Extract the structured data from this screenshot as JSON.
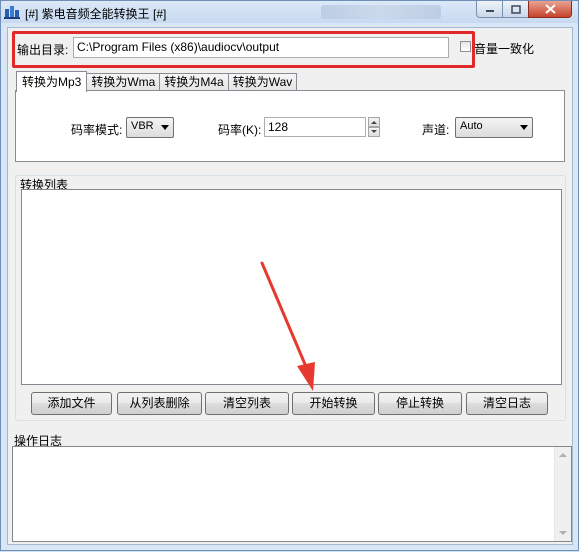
{
  "window": {
    "title": "[#] 紫电音频全能转换王 [#]",
    "controls": [
      "minimize-icon",
      "maximize-icon",
      "close-icon"
    ]
  },
  "output": {
    "label": "输出目录:",
    "path": "C:\\Program Files (x86)\\audiocv\\output",
    "volume_label": "音量一致化",
    "volume_checked": false
  },
  "tabs": [
    {
      "label": "转换为Mp3",
      "active": true
    },
    {
      "label": "转换为Wma",
      "active": false
    },
    {
      "label": "转换为M4a",
      "active": false
    },
    {
      "label": "转换为Wav",
      "active": false
    }
  ],
  "mp3_settings": {
    "mode_label": "码率模式:",
    "mode_value": "VBR",
    "bitrate_label": "码率(K):",
    "bitrate_value": "128",
    "channel_label": "声道:",
    "channel_value": "Auto"
  },
  "convert_list": {
    "label": "转换列表",
    "items": []
  },
  "buttons": {
    "add_file": "添加文件",
    "remove_from_list": "从列表删除",
    "clear_list": "清空列表",
    "start_convert": "开始转换",
    "stop_convert": "停止转换",
    "clear_log": "清空日志"
  },
  "log": {
    "label": "操作日志",
    "content": ""
  },
  "colors": {
    "highlight_box": "#e02a2a",
    "annotation_arrow": "#e8392f"
  }
}
